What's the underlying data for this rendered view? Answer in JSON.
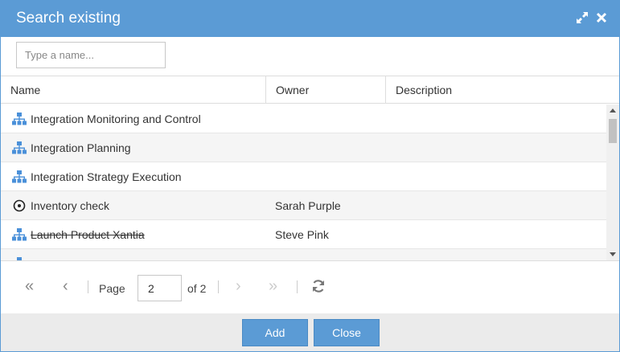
{
  "dialog": {
    "title": "Search existing",
    "maximize_icon": "expand-icon",
    "close_icon": "close-icon"
  },
  "search": {
    "placeholder": "Type a name...",
    "value": ""
  },
  "grid": {
    "columns": [
      "Name",
      "Owner",
      "Description"
    ],
    "rows": [
      {
        "name": "Integration Monitoring and Control",
        "owner": "",
        "description": "",
        "icon": "hierarchy-icon",
        "strike": false
      },
      {
        "name": "Integration Planning",
        "owner": "",
        "description": "",
        "icon": "hierarchy-icon",
        "strike": false
      },
      {
        "name": "Integration Strategy Execution",
        "owner": "",
        "description": "",
        "icon": "hierarchy-icon",
        "strike": false
      },
      {
        "name": "Inventory check",
        "owner": "Sarah Purple",
        "description": "",
        "icon": "target-icon",
        "strike": false
      },
      {
        "name": "Launch Product Xantia",
        "owner": "Steve Pink",
        "description": "",
        "icon": "hierarchy-icon",
        "strike": true
      }
    ]
  },
  "pager": {
    "page_label": "Page",
    "current_page": "2",
    "of_label": "of 2"
  },
  "footer": {
    "add_label": "Add",
    "close_label": "Close"
  },
  "colors": {
    "accent": "#5b9bd5",
    "icon_blue": "#4a90d9"
  }
}
